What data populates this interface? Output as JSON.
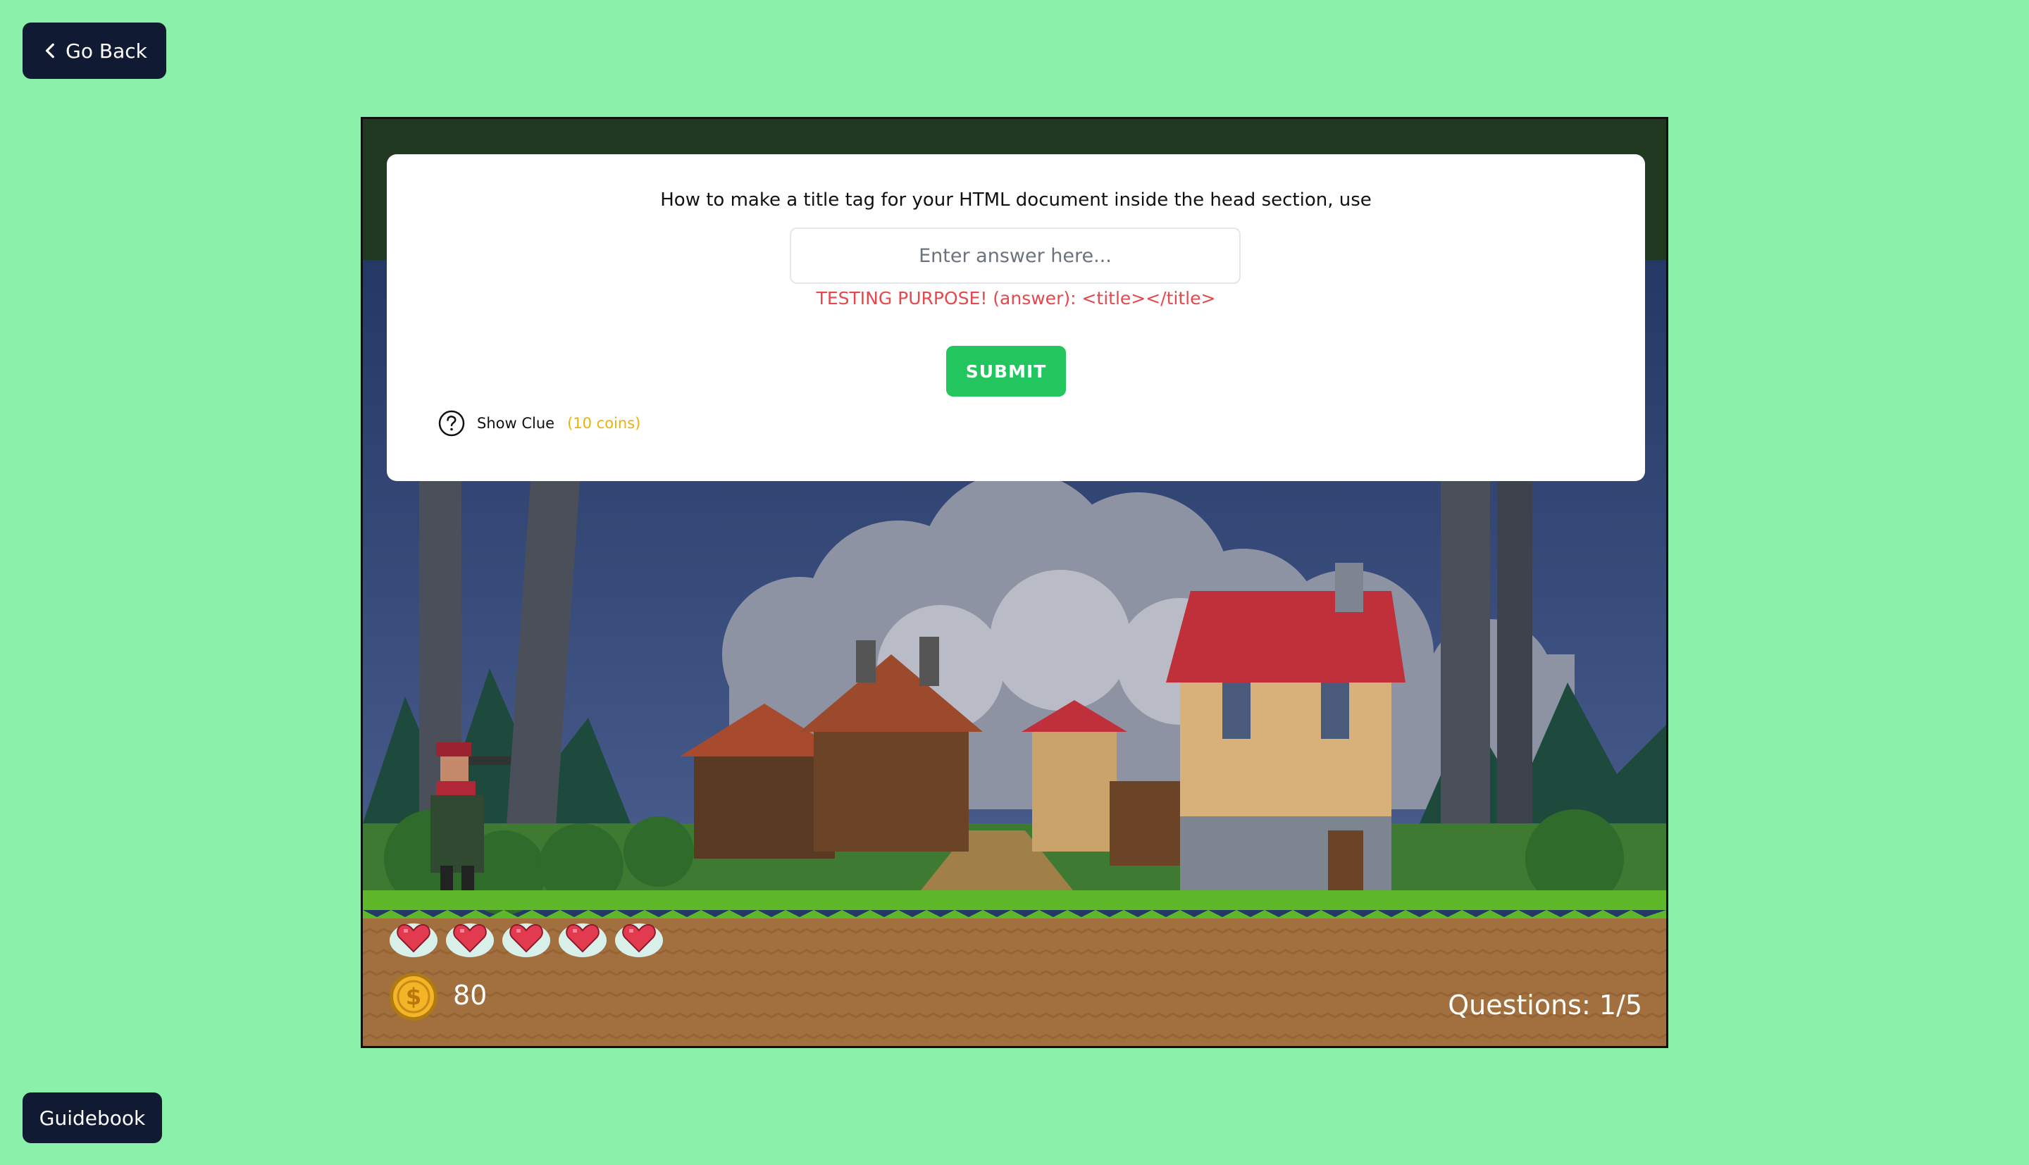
{
  "nav": {
    "back_label": "Go Back",
    "guidebook_label": "Guidebook"
  },
  "quiz": {
    "question": "How to make a title tag for your HTML document inside the head section, use",
    "answer_value": "",
    "answer_placeholder": "Enter answer here...",
    "testing_hint": "TESTING PURPOSE! (answer): <title></title>",
    "submit_label": "SUBMIT",
    "clue_label": "Show Clue",
    "clue_cost": "(10 coins)"
  },
  "hud": {
    "lives": 5,
    "coins": "80",
    "questions_progress": "Questions: 1/5"
  },
  "icons": {
    "back": "chevron-left-icon",
    "clue": "question-circle-icon",
    "life": "heart-icon",
    "coin": "coin-icon"
  },
  "colors": {
    "page_background": "#8af0aa",
    "nav_button": "#111a33",
    "submit": "#22c55e",
    "hint": "#e5484d",
    "clue_cost": "#eab308"
  }
}
